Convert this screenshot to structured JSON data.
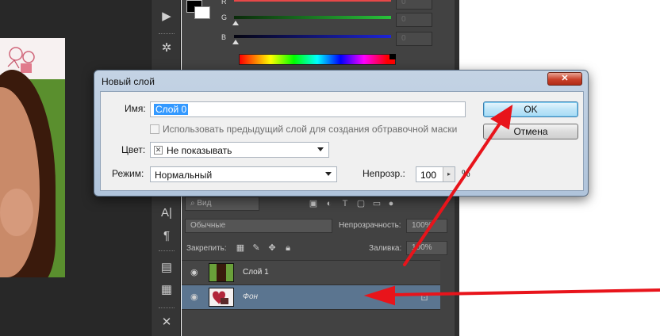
{
  "colors": {
    "panel_bg": "#424242",
    "dialog_accent": "#3c7fb1",
    "annotation_arrow": "#e8141b",
    "slider_r": "#e84848",
    "slider_g": "#28c33a",
    "slider_b": "#1d24d6"
  },
  "color_panel": {
    "channels": [
      {
        "label": "R",
        "value": "0"
      },
      {
        "label": "G",
        "value": "0"
      },
      {
        "label": "B",
        "value": "0"
      }
    ]
  },
  "layers_panel": {
    "filter_kind": "Вид",
    "blend_mode": "Обычные",
    "opacity_label": "Непрозрачность:",
    "opacity_value": "100%",
    "lock_label": "Закрепить:",
    "fill_label": "Заливка:",
    "fill_value": "100%",
    "layers": [
      {
        "name": "Слой 1",
        "selected": false
      },
      {
        "name": "Фон",
        "selected": true,
        "locked": true
      }
    ]
  },
  "dialog": {
    "title": "Новый слой",
    "close_icon": "close-icon",
    "name_label": "Имя:",
    "name_value": "Слой 0",
    "clipping_mask_label": "Использовать предыдущий слой для создания обтравочной маски",
    "clipping_mask_checked": false,
    "color_label": "Цвет:",
    "color_value": "Не показывать",
    "mode_label": "Режим:",
    "mode_value": "Нормальный",
    "opacity_label": "Непрозр.:",
    "opacity_value": "100",
    "opacity_unit": "%",
    "ok_label": "OK",
    "cancel_label": "Отмена"
  }
}
